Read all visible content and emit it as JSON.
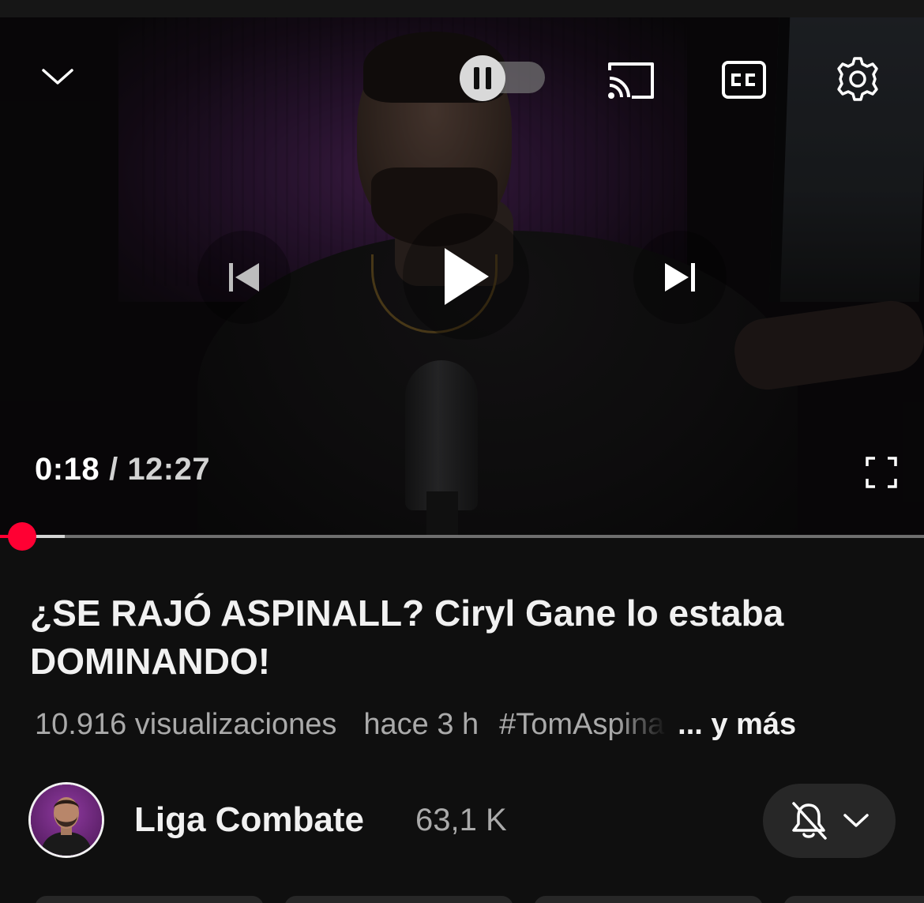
{
  "player": {
    "time_current": "0:18",
    "time_separator": "/",
    "time_total": "12:27",
    "progress_fraction": 0.024,
    "buffer_fraction": 0.07,
    "state": "paused",
    "autoplay": "on",
    "icons": {
      "collapse": "chevron-down-icon",
      "autoplay": "pause-icon",
      "cast": "cast-icon",
      "captions": "cc-icon",
      "settings": "gear-icon",
      "previous": "skip-previous-icon",
      "play": "play-icon",
      "next": "skip-next-icon",
      "fullscreen": "fullscreen-icon"
    },
    "accent_color": "#ff0033"
  },
  "video": {
    "title": "¿SE RAJÓ ASPINALL? Ciryl Gane lo estaba DOMINANDO!",
    "views": "10.916 visualizaciones",
    "age": "hace 3 h",
    "hashtag": "#TomAspinall",
    "more": "... y más"
  },
  "channel": {
    "name": "Liga Combate",
    "subscribers": "63,1 K",
    "notification_icon": "bell-off-icon",
    "dropdown_icon": "chevron-down-icon"
  }
}
